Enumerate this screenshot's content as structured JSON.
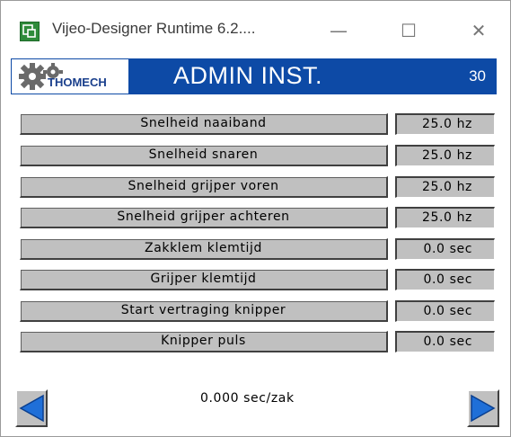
{
  "window": {
    "title": "Vijeo-Designer Runtime 6.2....",
    "controls": {
      "minimize": "—",
      "maximize": "☐",
      "close": "✕"
    }
  },
  "header": {
    "logo_text": "THOMECH",
    "title": "ADMIN INST.",
    "screen_number": "30",
    "color": "#0d4aa6"
  },
  "parameters": [
    {
      "label": "Snelheid naaiband",
      "value": "25.0 hz"
    },
    {
      "label": "Snelheid snaren",
      "value": "25.0 hz"
    },
    {
      "label": "Snelheid grijper voren",
      "value": "25.0 hz"
    },
    {
      "label": "Snelheid grijper achteren",
      "value": "25.0 hz"
    },
    {
      "label": "Zakklem klemtijd",
      "value": "0.0 sec"
    },
    {
      "label": "Grijper klemtijd",
      "value": "0.0 sec"
    },
    {
      "label": "Start vertraging knipper",
      "value": "0.0 sec"
    },
    {
      "label": "Knipper puls",
      "value": "0.0 sec"
    }
  ],
  "summary": "0.000 sec/zak",
  "icons": {
    "app": "vijeo-app-icon",
    "logo": "gear-logo-icon",
    "prev": "arrow-left-icon",
    "next": "arrow-right-icon"
  }
}
